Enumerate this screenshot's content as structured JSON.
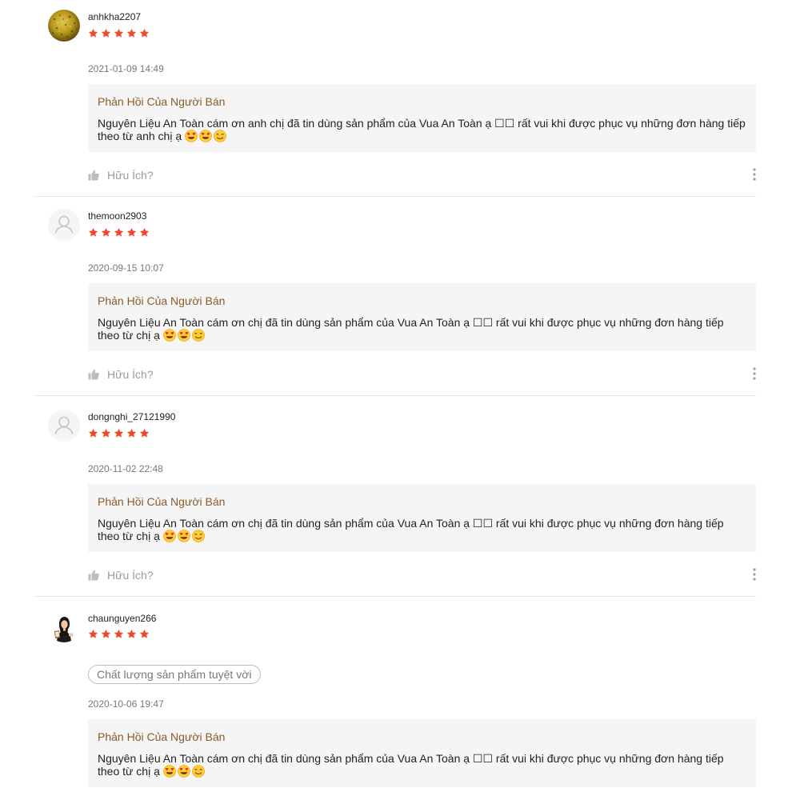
{
  "colors": {
    "star": "#ee4d2d",
    "reply_title": "#8b5a2b",
    "reply_bg": "#f5f5f5"
  },
  "icons": {
    "star": "star-icon",
    "helpful": "thumbs-up-icon",
    "more": "more-vertical-icon",
    "emoji": [
      "heart-eyes-emoji",
      "heart-eyes-emoji",
      "yum-emoji"
    ]
  },
  "reviews": [
    {
      "username": "anhkha2207",
      "rating": 5,
      "date": "2021-01-09 14:49",
      "reply_title": "Phản Hồi Của Người Bán",
      "reply_text": "Nguyên Liệu An Toàn cám ơn anh chị đã tin dùng sản phẩm của Vua An Toàn ạ ☐☐ rất vui khi được phục vụ những đơn hàng tiếp theo từ anh chị ạ",
      "helpful_label": "Hữu Ích?"
    },
    {
      "username": "themoon2903",
      "rating": 5,
      "date": "2020-09-15 10:07",
      "reply_title": "Phản Hồi Của Người Bán",
      "reply_text": "Nguyên Liệu An Toàn cám ơn chị đã tin dùng sản phẩm của Vua An Toàn ạ ☐☐ rất vui khi được phục vụ những đơn hàng tiếp theo từ chị ạ",
      "helpful_label": "Hữu Ích?"
    },
    {
      "username": "dongnghi_27121990",
      "rating": 5,
      "date": "2020-11-02 22:48",
      "reply_title": "Phản Hồi Của Người Bán",
      "reply_text": "Nguyên Liệu An Toàn cám ơn chị đã tin dùng sản phẩm của Vua An Toàn ạ ☐☐ rất vui khi được phục vụ những đơn hàng tiếp theo từ chị ạ",
      "helpful_label": "Hữu Ích?"
    },
    {
      "username": "chaunguyen266",
      "rating": 5,
      "tag": "Chất lượng sản phẩm tuyệt vời",
      "date": "2020-10-06 19:47",
      "reply_title": "Phản Hồi Của Người Bán",
      "reply_text": "Nguyên Liệu An Toàn cám ơn chị đã tin dùng sản phẩm của Vua An Toàn ạ ☐☐ rất vui khi được phục vụ những đơn hàng tiếp theo từ chị ạ"
    }
  ]
}
